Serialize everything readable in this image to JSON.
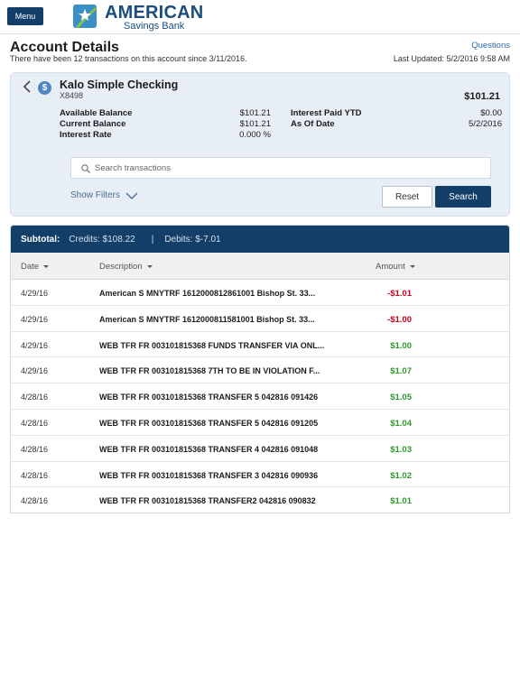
{
  "header": {
    "menu_label": "Menu",
    "logo_name": "AMERICAN",
    "logo_sub": "Savings Bank"
  },
  "page": {
    "title": "Account Details",
    "subtitle": "There have been 12 transactions on this account since 3/11/2016.",
    "questions": "Questions",
    "last_updated": "Last Updated: 5/2/2016 9:58 AM"
  },
  "account": {
    "name": "Kalo Simple Checking",
    "number": "X8498",
    "total": "$101.21",
    "details": [
      {
        "label": "Available Balance",
        "value": "$101.21"
      },
      {
        "label": "Current Balance",
        "value": "$101.21"
      },
      {
        "label": "Interest Rate",
        "value": "0.000 %"
      },
      {
        "label": "Interest Paid YTD",
        "value": "$0.00"
      },
      {
        "label": "As Of Date",
        "value": "5/2/2016"
      }
    ]
  },
  "search": {
    "placeholder": "Search transactions",
    "show_filters": "Show Filters",
    "reset": "Reset",
    "search": "Search"
  },
  "subtotal": {
    "label": "Subtotal:",
    "credits": "Credits:  $108.22",
    "sep": "|",
    "debits": "Debits:  $-7.01"
  },
  "columns": {
    "date": "Date",
    "description": "Description",
    "amount": "Amount"
  },
  "transactions": [
    {
      "date": "4/29/16",
      "desc": "American S MNYTRF 1612000812861001 Bishop St. 33...",
      "amount": "-$1.01",
      "type": "neg"
    },
    {
      "date": "4/29/16",
      "desc": "American S MNYTRF 1612000811581001 Bishop St. 33...",
      "amount": "-$1.00",
      "type": "neg"
    },
    {
      "date": "4/29/16",
      "desc": "WEB TFR FR 003101815368 FUNDS TRANSFER VIA ONL...",
      "amount": "$1.00",
      "type": "pos"
    },
    {
      "date": "4/29/16",
      "desc": "WEB TFR FR 003101815368 7TH TO BE IN VIOLATION F...",
      "amount": "$1.07",
      "type": "pos"
    },
    {
      "date": "4/28/16",
      "desc": "WEB TFR FR 003101815368 TRANSFER 5 042816 091426",
      "amount": "$1.05",
      "type": "pos"
    },
    {
      "date": "4/28/16",
      "desc": "WEB TFR FR 003101815368 TRANSFER 5 042816 091205",
      "amount": "$1.04",
      "type": "pos"
    },
    {
      "date": "4/28/16",
      "desc": "WEB TFR FR 003101815368 TRANSFER 4 042816 091048",
      "amount": "$1.03",
      "type": "pos"
    },
    {
      "date": "4/28/16",
      "desc": "WEB TFR FR 003101815368 TRANSFER 3 042816 090936",
      "amount": "$1.02",
      "type": "pos"
    },
    {
      "date": "4/28/16",
      "desc": "WEB TFR FR 003101815368 TRANSFER2 042816 090832",
      "amount": "$1.01",
      "type": "pos"
    }
  ],
  "colors": {
    "brand": "#123e68",
    "positive": "#2c9a2c",
    "negative": "#d0021b",
    "panel": "#e8eef5"
  },
  "icons": [
    "logo-star-icon",
    "back-chevron-icon",
    "dollar-icon",
    "search-icon",
    "chevron-down-icon",
    "sort-caret-icon"
  ]
}
